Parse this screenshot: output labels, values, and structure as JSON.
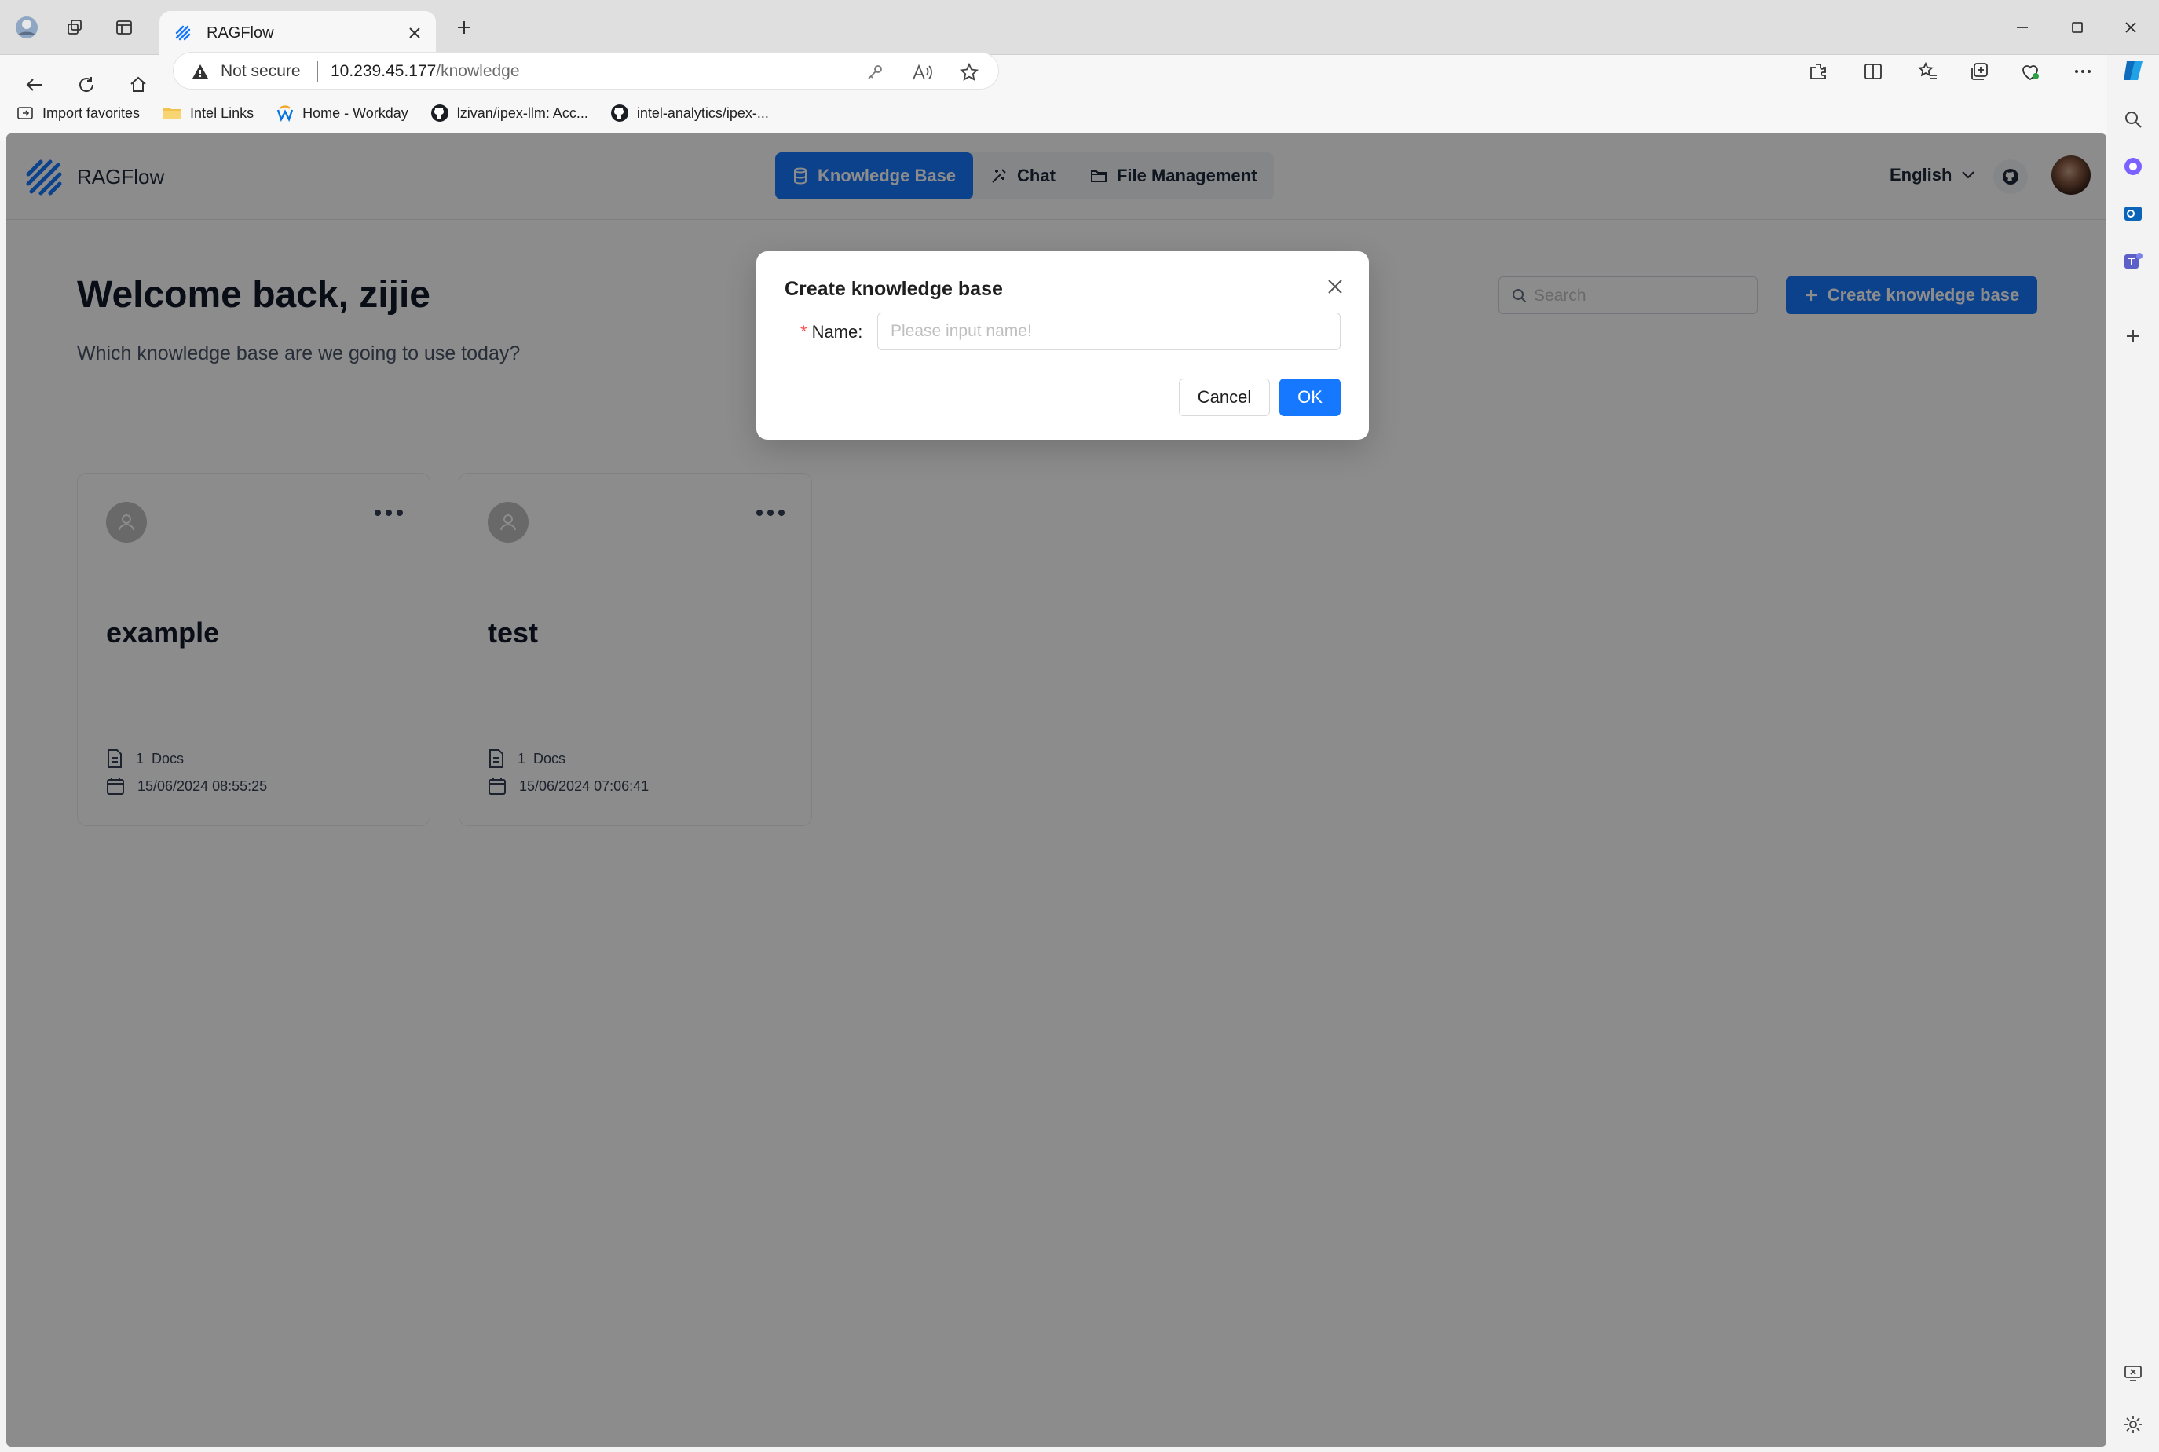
{
  "browser": {
    "tab_title": "RAGFlow",
    "security_label": "Not secure",
    "url_host": "10.239.45.177",
    "url_path": "/knowledge",
    "favorites": [
      {
        "label": "Import favorites",
        "icon": "import-icon"
      },
      {
        "label": "Intel Links",
        "icon": "folder-icon"
      },
      {
        "label": "Home - Workday",
        "icon": "workday-icon"
      },
      {
        "label": "lzivan/ipex-llm: Acc...",
        "icon": "github-icon"
      },
      {
        "label": "intel-analytics/ipex-...",
        "icon": "github-icon"
      }
    ]
  },
  "app": {
    "brand": "RAGFlow",
    "nav": {
      "knowledge_base": "Knowledge Base",
      "chat": "Chat",
      "file_management": "File Management"
    },
    "language": "English"
  },
  "page": {
    "welcome": "Welcome back, zijie",
    "subtitle": "Which knowledge base are we going to use today?",
    "search_placeholder": "Search",
    "create_button": "Create knowledge base"
  },
  "cards": [
    {
      "name": "example",
      "docs_count": "1",
      "docs_label": "Docs",
      "date": "15/06/2024 08:55:25"
    },
    {
      "name": "test",
      "docs_count": "1",
      "docs_label": "Docs",
      "date": "15/06/2024 07:06:41"
    }
  ],
  "modal": {
    "title": "Create knowledge base",
    "required_mark": "*",
    "name_label": "Name",
    "name_colon": ":",
    "name_placeholder": "Please input name!",
    "name_value": "",
    "cancel": "Cancel",
    "ok": "OK"
  },
  "colors": {
    "primary": "#1677ff",
    "required": "#ff4d4f",
    "overlay": "rgba(0,0,0,0.45)"
  }
}
